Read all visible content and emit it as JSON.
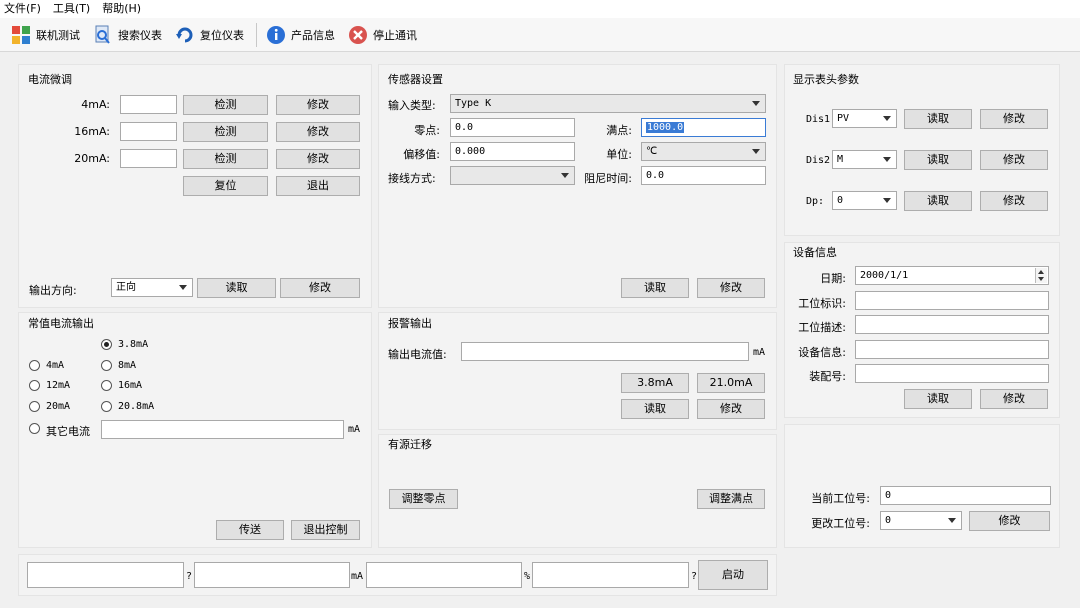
{
  "menu": [
    "文件(F)",
    "工具(T)",
    "帮助(H)"
  ],
  "toolbar": {
    "connect_test": "联机测试",
    "search_meter": "搜索仪表",
    "reset_meter": "复位仪表",
    "product_info": "产品信息",
    "stop_comm": "停止通讯"
  },
  "current_calib": {
    "title": "电流微调",
    "rows": [
      {
        "label": "4mA:",
        "value": "",
        "detect": "检测",
        "modify": "修改"
      },
      {
        "label": "16mA:",
        "value": "",
        "detect": "检测",
        "modify": "修改"
      },
      {
        "label": "20mA:",
        "value": "",
        "detect": "检测",
        "modify": "修改"
      }
    ],
    "reset": "复位",
    "exit": "退出",
    "output_dir_label": "输出方向:",
    "output_dir_value": "正向",
    "read": "读取",
    "modify": "修改"
  },
  "sensor": {
    "title": "传感器设置",
    "input_type_label": "输入类型:",
    "input_type_value": "Type K",
    "zero_label": "零点:",
    "zero_value": "0.0",
    "full_label": "满点:",
    "full_value": "1000.0",
    "offset_label": "偏移值:",
    "offset_value": "0.000",
    "unit_label": "单位:",
    "unit_value": "℃",
    "wiring_label": "接线方式:",
    "wiring_value": "",
    "damping_label": "阻尼时间:",
    "damping_value": "0.0",
    "read": "读取",
    "modify": "修改"
  },
  "display": {
    "title": "显示表头参数",
    "rows": [
      {
        "label": "Dis1:",
        "value": "PV",
        "read": "读取",
        "modify": "修改"
      },
      {
        "label": "Dis2:",
        "value": "M",
        "read": "读取",
        "modify": "修改"
      },
      {
        "label": "Dp:",
        "value": "0",
        "read": "读取",
        "modify": "修改"
      }
    ]
  },
  "device": {
    "title": "设备信息",
    "date_label": "日期:",
    "date_value": "2000/1/1",
    "tag_label": "工位标识:",
    "tag_value": "",
    "desc_label": "工位描述:",
    "desc_value": "",
    "info_label": "设备信息:",
    "info_value": "",
    "assembly_label": "装配号:",
    "assembly_value": "",
    "read": "读取",
    "modify": "修改"
  },
  "constant": {
    "title": "常值电流输出",
    "options": [
      "3.8mA",
      "4mA",
      "8mA",
      "12mA",
      "16mA",
      "20mA",
      "20.8mA",
      "其它电流"
    ],
    "selected": "3.8mA",
    "other_value": "",
    "unit": "mA",
    "send": "传送",
    "exit_control": "退出控制"
  },
  "alarm": {
    "title": "报警输出",
    "output_label": "输出电流值:",
    "output_value": "",
    "unit": "mA",
    "low": "3.8mA",
    "high": "21.0mA",
    "read": "读取",
    "modify": "修改"
  },
  "migration": {
    "title": "有源迁移",
    "adjust_zero": "调整零点",
    "adjust_full": "调整满点"
  },
  "station": {
    "current_label": "当前工位号:",
    "current_value": "0",
    "change_label": "更改工位号:",
    "change_value": "0",
    "modify": "修改"
  },
  "status": {
    "field1": "",
    "sfx1": "?",
    "field2": "",
    "sfx2": "mA",
    "field3": "",
    "sfx3": "%",
    "field4": "",
    "sfx4": "?",
    "start": "启动"
  },
  "colors": {
    "accent_blue": "#2a6fd6",
    "selection": "#3a7bd5"
  }
}
